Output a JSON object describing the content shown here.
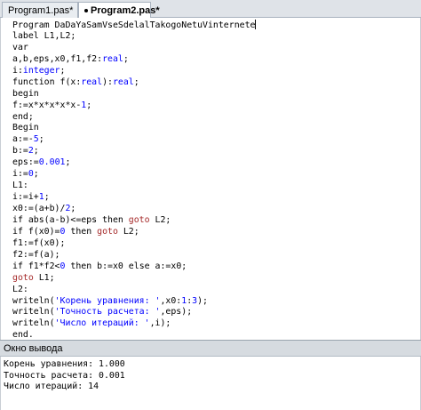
{
  "tabs": [
    {
      "label": "Program1.pas*",
      "active": false
    },
    {
      "label": "Program2.pas*",
      "active": true
    }
  ],
  "editor": {
    "lines": [
      [
        {
          "t": "Program DaDaYaSamVseSdelalTakogoNetuVinternete",
          "c": "kw"
        }
      ],
      [
        {
          "t": "label L1,L2;",
          "c": "kw"
        }
      ],
      [
        {
          "t": "var",
          "c": "kw"
        }
      ],
      [
        {
          "t": "a,b,eps,x0,f1,f2:",
          "c": "op"
        },
        {
          "t": "real",
          "c": "type"
        },
        {
          "t": ";",
          "c": "op"
        }
      ],
      [
        {
          "t": "i:",
          "c": "op"
        },
        {
          "t": "integer",
          "c": "type"
        },
        {
          "t": ";",
          "c": "op"
        }
      ],
      [
        {
          "t": "function f(x:",
          "c": "kw"
        },
        {
          "t": "real",
          "c": "type"
        },
        {
          "t": "):",
          "c": "op"
        },
        {
          "t": "real",
          "c": "type"
        },
        {
          "t": ";",
          "c": "op"
        }
      ],
      [
        {
          "t": "begin",
          "c": "kw"
        }
      ],
      [
        {
          "t": "f:=x*x*x*x*x-",
          "c": "op"
        },
        {
          "t": "1",
          "c": "num"
        },
        {
          "t": ";",
          "c": "op"
        }
      ],
      [
        {
          "t": "end;",
          "c": "kw"
        }
      ],
      [
        {
          "t": "Begin",
          "c": "kw"
        }
      ],
      [
        {
          "t": "a:=-",
          "c": "op"
        },
        {
          "t": "5",
          "c": "num"
        },
        {
          "t": ";",
          "c": "op"
        }
      ],
      [
        {
          "t": "b:=",
          "c": "op"
        },
        {
          "t": "2",
          "c": "num"
        },
        {
          "t": ";",
          "c": "op"
        }
      ],
      [
        {
          "t": "eps:=",
          "c": "op"
        },
        {
          "t": "0.001",
          "c": "num"
        },
        {
          "t": ";",
          "c": "op"
        }
      ],
      [
        {
          "t": "i:=",
          "c": "op"
        },
        {
          "t": "0",
          "c": "num"
        },
        {
          "t": ";",
          "c": "op"
        }
      ],
      [
        {
          "t": "L1:",
          "c": "op"
        }
      ],
      [
        {
          "t": "i:=i+",
          "c": "op"
        },
        {
          "t": "1",
          "c": "num"
        },
        {
          "t": ";",
          "c": "op"
        }
      ],
      [
        {
          "t": "x0:=(a+b)/",
          "c": "op"
        },
        {
          "t": "2",
          "c": "num"
        },
        {
          "t": ";",
          "c": "op"
        }
      ],
      [
        {
          "t": "if abs(a-b)<=eps then ",
          "c": "kw"
        },
        {
          "t": "goto",
          "c": "gt"
        },
        {
          "t": " L2;",
          "c": "op"
        }
      ],
      [
        {
          "t": "if f(x0)=",
          "c": "kw"
        },
        {
          "t": "0",
          "c": "num"
        },
        {
          "t": " then ",
          "c": "kw"
        },
        {
          "t": "goto",
          "c": "gt"
        },
        {
          "t": " L2;",
          "c": "op"
        }
      ],
      [
        {
          "t": "f1:=f(x0);",
          "c": "op"
        }
      ],
      [
        {
          "t": "f2:=f(a);",
          "c": "op"
        }
      ],
      [
        {
          "t": "if f1*f2<",
          "c": "kw"
        },
        {
          "t": "0",
          "c": "num"
        },
        {
          "t": " then b:=x0 else a:=x0;",
          "c": "kw"
        }
      ],
      [
        {
          "t": "goto",
          "c": "gt"
        },
        {
          "t": " L1;",
          "c": "op"
        }
      ],
      [
        {
          "t": "L2:",
          "c": "op"
        }
      ],
      [
        {
          "t": "writeln(",
          "c": "op"
        },
        {
          "t": "'Корень уравнения: '",
          "c": "str"
        },
        {
          "t": ",x0:",
          "c": "op"
        },
        {
          "t": "1",
          "c": "num"
        },
        {
          "t": ":",
          "c": "op"
        },
        {
          "t": "3",
          "c": "num"
        },
        {
          "t": ");",
          "c": "op"
        }
      ],
      [
        {
          "t": "writeln(",
          "c": "op"
        },
        {
          "t": "'Точность расчета: '",
          "c": "str"
        },
        {
          "t": ",eps);",
          "c": "op"
        }
      ],
      [
        {
          "t": "writeln(",
          "c": "op"
        },
        {
          "t": "'Число итераций: '",
          "c": "str"
        },
        {
          "t": ",i);",
          "c": "op"
        }
      ],
      [
        {
          "t": "end.",
          "c": "kw"
        }
      ]
    ]
  },
  "output": {
    "title": "Окно вывода",
    "lines": [
      "Корень уравнения: 1.000",
      "Точность расчета: 0.001",
      "Число итераций: 14"
    ]
  }
}
